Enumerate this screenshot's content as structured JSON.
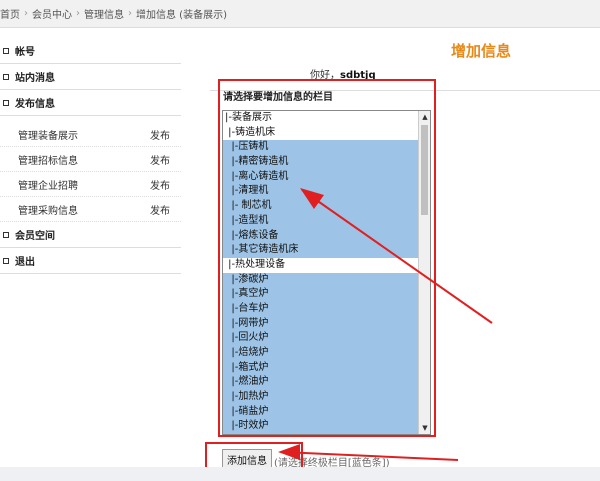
{
  "breadcrumb": {
    "items": [
      "首页",
      "会员中心",
      "管理信息",
      "增加信息 (装备展示)"
    ],
    "sep": "›"
  },
  "sidebar": {
    "sections": [
      {
        "label": "帐号"
      },
      {
        "label": "站内消息"
      },
      {
        "label": "发布信息",
        "subs": [
          {
            "label": "管理装备展示",
            "action": "发布"
          },
          {
            "label": "管理招标信息",
            "action": "发布"
          },
          {
            "label": "管理企业招聘",
            "action": "发布"
          },
          {
            "label": "管理采购信息",
            "action": "发布"
          }
        ]
      },
      {
        "label": "会员空间"
      },
      {
        "label": "退出"
      }
    ]
  },
  "main": {
    "title": "增加信息",
    "greeting_prefix": "你好，",
    "username": "sdbtjq",
    "choose_label": "请选择要增加信息的栏目",
    "options": [
      {
        "text": "|-装备展示",
        "selected": false
      },
      {
        "text": " |-铸造机床",
        "selected": false
      },
      {
        "text": "  |-压铸机",
        "selected": true
      },
      {
        "text": "  |-精密铸造机",
        "selected": true
      },
      {
        "text": "  |-离心铸造机",
        "selected": true
      },
      {
        "text": "  |-清理机",
        "selected": true
      },
      {
        "text": "  |- 制芯机",
        "selected": true
      },
      {
        "text": "  |-造型机",
        "selected": true
      },
      {
        "text": "  |-熔炼设备",
        "selected": true
      },
      {
        "text": "  |-其它铸造机床",
        "selected": true
      },
      {
        "text": " |-热处理设备",
        "selected": false
      },
      {
        "text": "  |-渗碳炉",
        "selected": true
      },
      {
        "text": "  |-真空炉",
        "selected": true
      },
      {
        "text": "  |-台车炉",
        "selected": true
      },
      {
        "text": "  |-网带炉",
        "selected": true
      },
      {
        "text": "  |-回火炉",
        "selected": true
      },
      {
        "text": "  |-焙烧炉",
        "selected": true
      },
      {
        "text": "  |-箱式炉",
        "selected": true
      },
      {
        "text": "  |-燃油炉",
        "selected": true
      },
      {
        "text": "  |-加热炉",
        "selected": true
      },
      {
        "text": "  |-硝盐炉",
        "selected": true
      },
      {
        "text": "  |-时效炉",
        "selected": true
      }
    ],
    "add_button": "添加信息",
    "hint": "(请选择终极栏目[蓝色条])"
  },
  "colors": {
    "accent_title": "#e88a1a",
    "selected_bg": "#9dc3e6",
    "annotation_red": "#e02020"
  }
}
